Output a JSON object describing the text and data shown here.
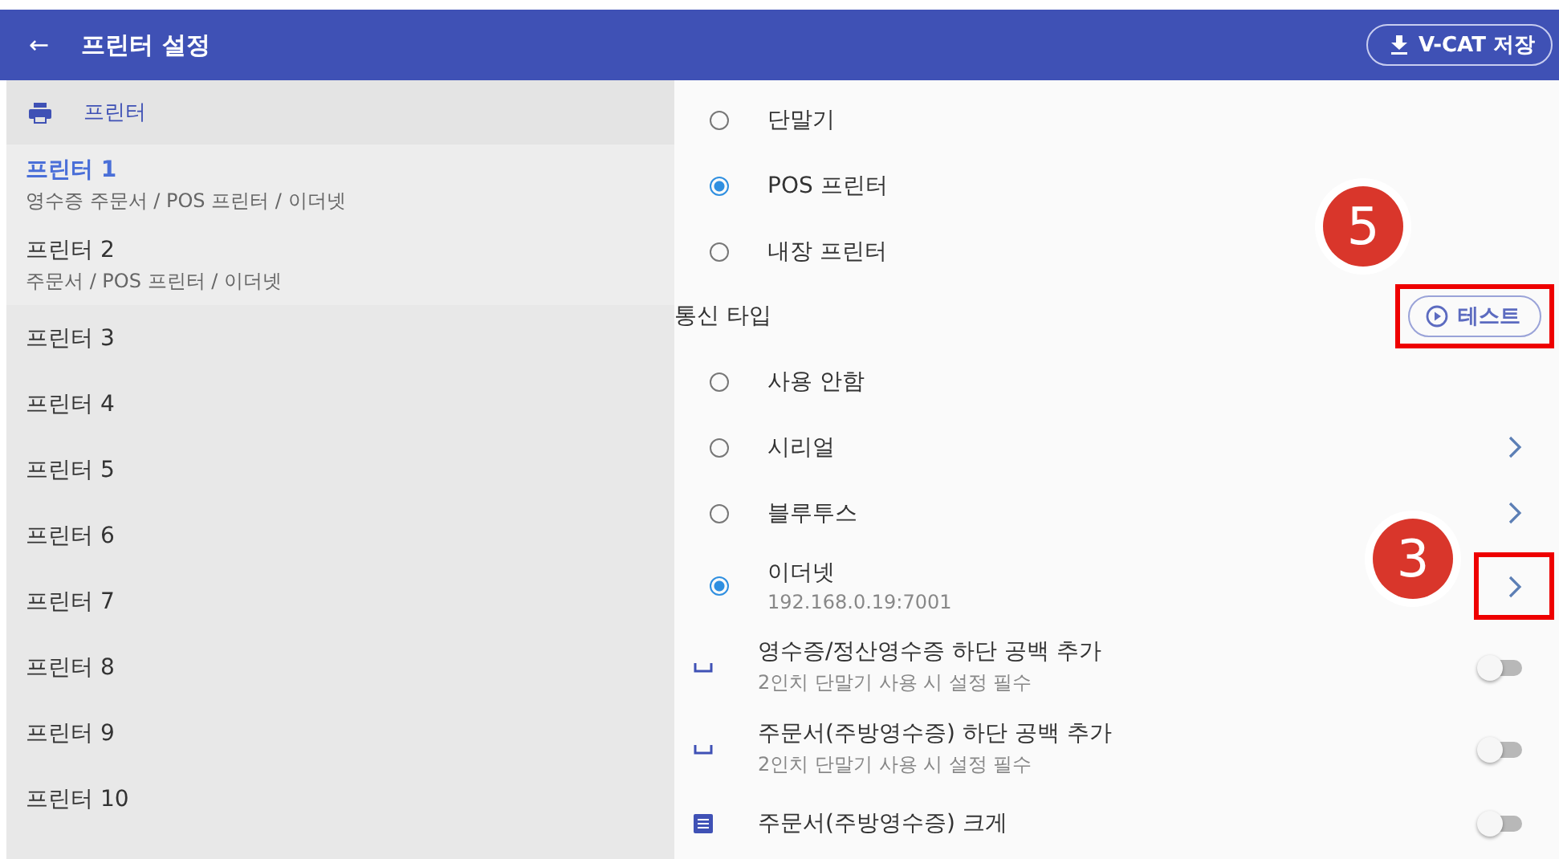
{
  "app_bar": {
    "back": "←",
    "title": "프린터 설정",
    "save_button": "V-CAT 저장"
  },
  "sidebar": {
    "header": "프린터",
    "items": [
      {
        "name": "프린터 1",
        "detail": "영수증 주문서 / POS 프린터 / 이더넷",
        "selected": true
      },
      {
        "name": "프린터 2",
        "detail": "주문서 / POS 프린터 / 이더넷",
        "selected": false
      },
      {
        "name": "프린터 3",
        "selected": false
      },
      {
        "name": "프린터 4",
        "selected": false
      },
      {
        "name": "프린터 5",
        "selected": false
      },
      {
        "name": "프린터 6",
        "selected": false
      },
      {
        "name": "프린터 7",
        "selected": false
      },
      {
        "name": "프린터 8",
        "selected": false
      },
      {
        "name": "프린터 9",
        "selected": false
      },
      {
        "name": "프린터 10",
        "selected": false
      }
    ]
  },
  "device_types": [
    {
      "label": "단말기",
      "selected": false
    },
    {
      "label": "POS 프린터",
      "selected": true
    },
    {
      "label": "내장 프린터",
      "selected": false
    }
  ],
  "comm_section": {
    "title": "통신 타입",
    "test_button": "테스트",
    "badge": "5",
    "highlighted": true
  },
  "comm_types": [
    {
      "label": "사용 안함",
      "selected": false,
      "arrow": false
    },
    {
      "label": "시리얼",
      "selected": false,
      "arrow": true,
      "highlighted": false
    },
    {
      "label": "블루투스",
      "selected": false,
      "arrow": true,
      "highlighted": false
    },
    {
      "label": "이더넷",
      "detail": "192.168.0.19:7001",
      "selected": true,
      "arrow": true,
      "badge": "3",
      "highlighted": true
    }
  ],
  "options": [
    {
      "kind": "space",
      "title": "영수증/정산영수증 하단 공백 추가",
      "detail": "2인치 단말기 사용 시 설정 필수",
      "on": false
    },
    {
      "kind": "space",
      "title": "주문서(주방영수증) 하단 공백 추가",
      "detail": "2인치 단말기 사용 시 설정 필수",
      "on": false
    },
    {
      "kind": "list",
      "title": "주문서(주방영수증) 크게",
      "on": false
    }
  ]
}
